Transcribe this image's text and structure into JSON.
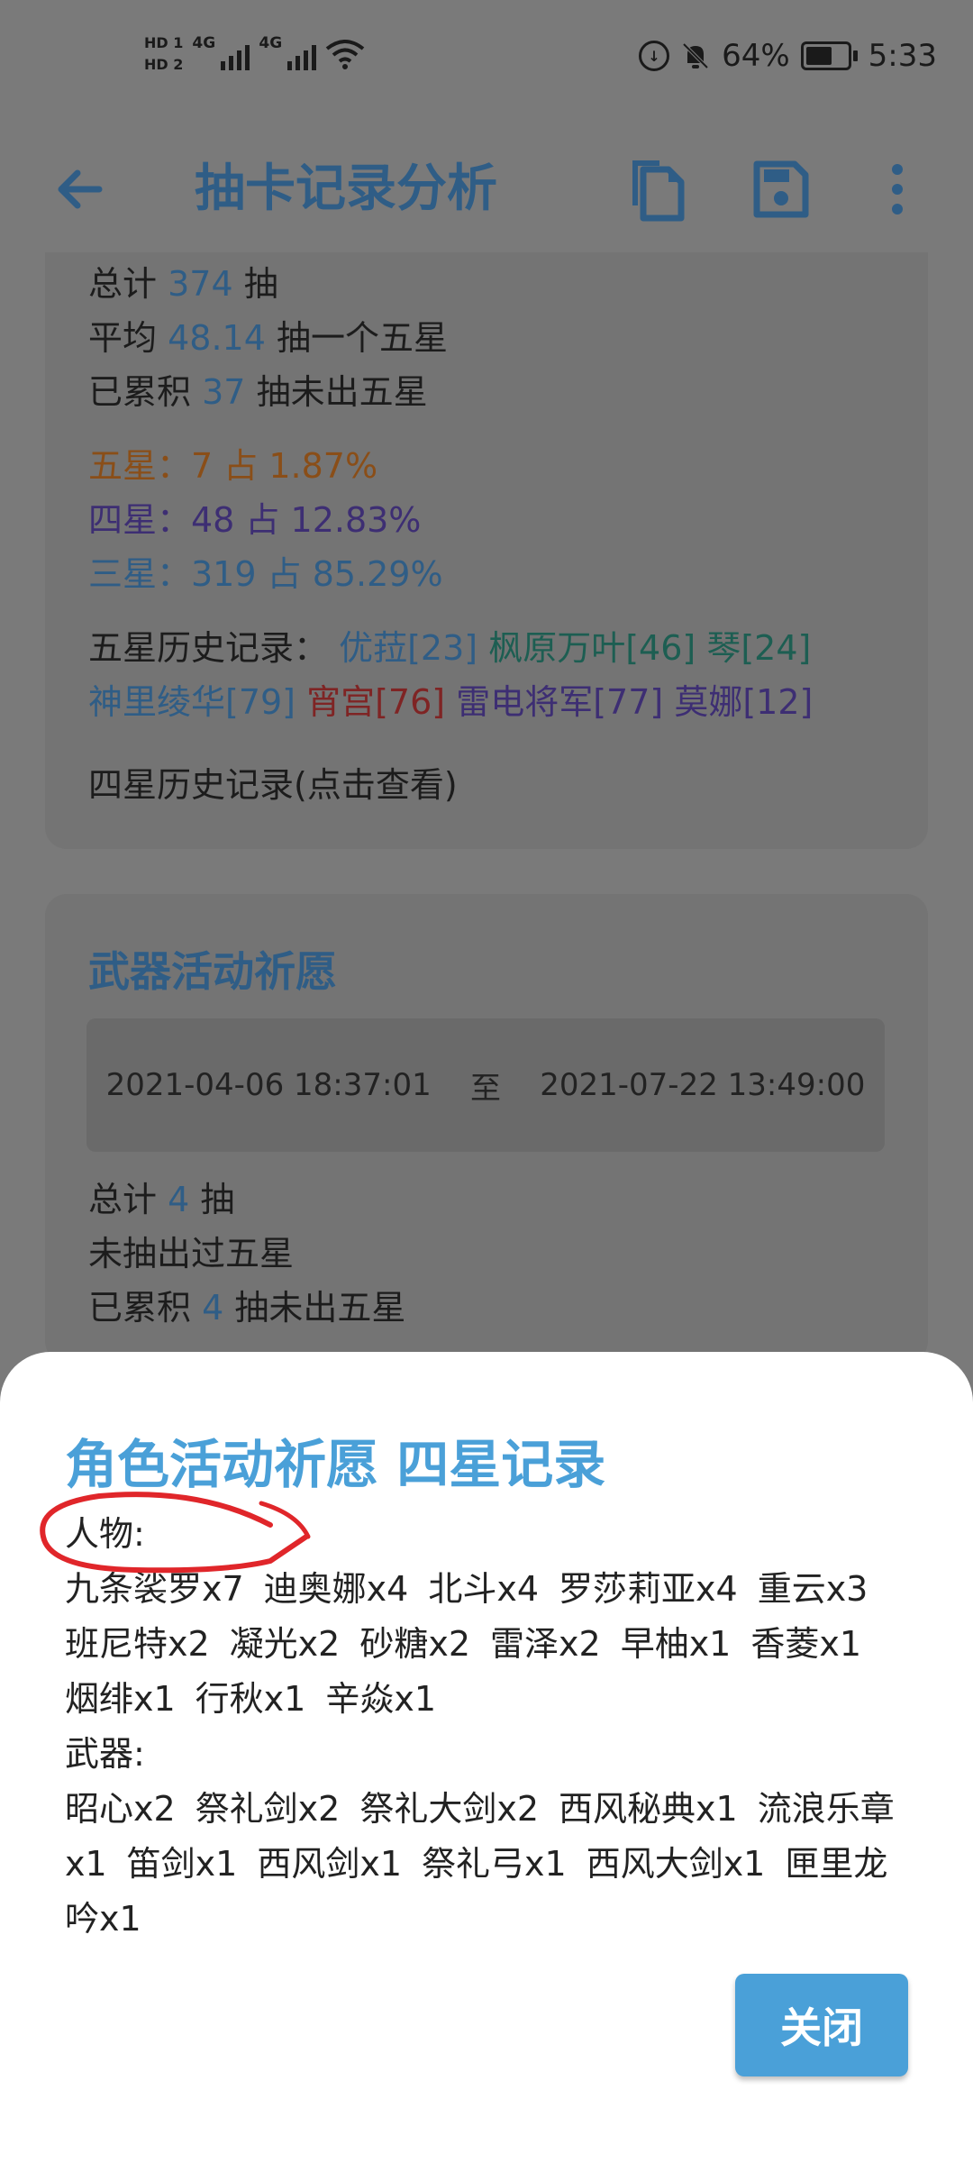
{
  "status": {
    "hd1": "HD 1",
    "hd2": "HD 2",
    "net1": "4G",
    "net2": "4G",
    "battery_percent": "64%",
    "battery_level": 0.64,
    "time": "5:33",
    "icons": [
      "signal-icon",
      "wifi-icon",
      "data-saver-icon",
      "bell-off-icon",
      "battery-icon"
    ]
  },
  "appbar": {
    "title": "抽卡记录分析",
    "icons": [
      "back-arrow-icon",
      "copy-icon",
      "save-icon",
      "more-vert-icon"
    ],
    "accent": "#2f5d86"
  },
  "character_pool": {
    "total_prefix": "总计",
    "total": "374",
    "total_suffix": "抽",
    "avg_prefix": "平均",
    "avg": "48.14",
    "avg_suffix": "抽一个五星",
    "accum_prefix": "已累积",
    "accum": "37",
    "accum_suffix": "抽未出五星",
    "five_star": "五星：7 占 1.87%",
    "four_star": "四星：48 占 12.83%",
    "three_star": "三星：319 占 85.29%",
    "history_label": "五星历史记录：",
    "history": [
      {
        "text": "优菈[23]",
        "color": "#2f5d86"
      },
      {
        "text": "枫原万叶[46]",
        "color": "#1d5e52"
      },
      {
        "text": "琴[24]",
        "color": "#1d5e52"
      },
      {
        "text": "神里绫华[79]",
        "color": "#2f5d86"
      },
      {
        "text": "宵宫[76]",
        "color": "#7f2424"
      },
      {
        "text": "雷电将军[77]",
        "color": "#3d2e73"
      },
      {
        "text": "莫娜[12]",
        "color": "#3d2e73"
      }
    ],
    "four_star_link": "四星历史记录(点击查看)"
  },
  "weapon_pool": {
    "title": "武器活动祈愿",
    "date_from": "2021-04-06 18:37:01",
    "date_sep": "至",
    "date_to": "2021-07-22 13:49:00",
    "total_prefix": "总计",
    "total": "4",
    "total_suffix": "抽",
    "never": "未抽出过五星",
    "accum_prefix": "已累积",
    "accum": "4",
    "accum_suffix": "抽未出五星"
  },
  "sheet": {
    "title": "角色活动祈愿 四星记录",
    "characters_label": "人物:",
    "characters": [
      "九条裟罗x7",
      "迪奥娜x4",
      "北斗x4",
      "罗莎莉亚x4",
      "重云x3",
      "班尼特x2",
      "凝光x2",
      "砂糖x2",
      "雷泽x2",
      "早柚x1",
      "香菱x1",
      "烟绯x1",
      "行秋x1",
      "辛焱x1"
    ],
    "weapons_label": "武器:",
    "weapons": [
      "昭心x2",
      "祭礼剑x2",
      "祭礼大剑x2",
      "西风秘典x1",
      "流浪乐章x1",
      "笛剑x1",
      "西风剑x1",
      "祭礼弓x1",
      "西风大剑x1",
      "匣里龙吟x1"
    ],
    "close_label": "关闭",
    "accent": "#4aa0d8",
    "annotation_color": "#e0262a"
  }
}
